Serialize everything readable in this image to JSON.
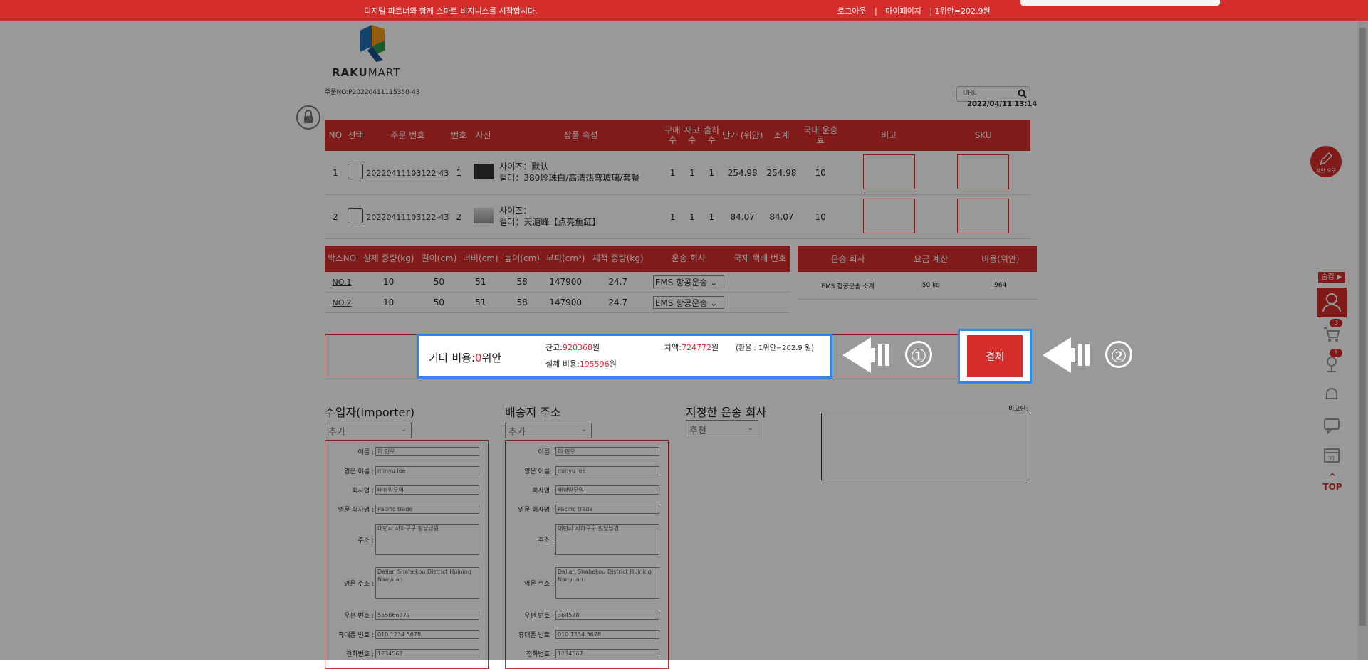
{
  "topbar": {
    "slogan": "디지털 파트너와 함께 스마트 비지니스를 시작합시다.",
    "logout": "로그아웃",
    "sep": "|",
    "mypage": "마이페이지",
    "rate": "| 1위안=202.9원"
  },
  "logo": {
    "text_a": "RAKU",
    "text_b": "MART"
  },
  "order_no": "주문NO:P20220411115350-43",
  "search": {
    "placeholder": "URL"
  },
  "datetime": "2022/04/11 13:14",
  "products": {
    "headers": [
      "NO",
      "선택",
      "주문 번호",
      "번호",
      "사진",
      "상품 속성",
      "구매수",
      "재고수",
      "출하수",
      "단가 (위안)",
      "소계",
      "국내 운송료",
      "비고",
      "SKU"
    ],
    "rows": [
      {
        "no": "1",
        "order": "20220411103122-43",
        "num": "1",
        "size": "사이즈：默认",
        "color": "컬러：380珍珠白/高清热弯玻璃/套餐",
        "buy": "1",
        "stock": "1",
        "ship": "1",
        "price": "254.98",
        "subtotal": "254.98",
        "domestic": "10"
      },
      {
        "no": "2",
        "order": "20220411103122-43",
        "num": "2",
        "size": "사이즈：",
        "color": "컬러：天溏峰【点亮鱼缸】",
        "buy": "1",
        "stock": "1",
        "ship": "1",
        "price": "84.07",
        "subtotal": "84.07",
        "domestic": "10"
      }
    ]
  },
  "boxes": {
    "headers": [
      "박스NO",
      "실제 중량(kg)",
      "길이(cm)",
      "너비(cm)",
      "높이(cm)",
      "부피(cm³)",
      "체적 중량(kg)",
      "운송 회사",
      "국제 택배 번호"
    ],
    "rows": [
      {
        "box": "NO.1",
        "weight": "10",
        "length": "50",
        "width": "51",
        "height": "58",
        "volume": "147900",
        "vol_weight": "24.7",
        "carrier": "EMS 항공운송"
      },
      {
        "box": "NO.2",
        "weight": "10",
        "length": "50",
        "width": "51",
        "height": "58",
        "volume": "147900",
        "vol_weight": "24.7",
        "carrier": "EMS 항공운송"
      }
    ]
  },
  "shipping_fee": {
    "headers": [
      "운송 회사",
      "요금 계산",
      "비용(위안)"
    ],
    "row": {
      "carrier": "EMS 항공운송 소계",
      "calc": "50 kg",
      "cost": "964"
    }
  },
  "payment": {
    "other_label": "기타 비용:",
    "other_value": "0",
    "other_unit": "위안",
    "balance_label": "잔고:",
    "balance_value": "920368",
    "balance_unit": "원",
    "actual_label": "실제 비용:",
    "actual_value": "195596",
    "actual_unit": "원",
    "diff_label": "차액:",
    "diff_value": "724772",
    "diff_unit": "원",
    "rate": "(환율 : 1위안=202.9 원)",
    "pay_button": "결제",
    "step1": "①",
    "step2": "②"
  },
  "importer": {
    "title": "수입자(Importer)",
    "select": "추가",
    "labels": [
      "이름 :",
      "영문 이름 :",
      "회사명 :",
      "영문 회사명 :",
      "주소 :",
      "영문 주소 :",
      "우편 번호 :",
      "휴대폰 번호 :",
      "전화번호 :"
    ],
    "values": [
      "이 민우",
      "minyu lee",
      "태평양무역",
      "Pacific trade",
      "대련시 사하구구 훤닝남원",
      "Dalian Shahekou District Huining Nanyuan",
      "555666777",
      "010 1234 5678",
      "1234567"
    ]
  },
  "delivery": {
    "title": "배송지 주소",
    "select": "추가",
    "labels": [
      "이름 :",
      "영문 이름 :",
      "회사명 :",
      "영문 회사명 :",
      "주소 :",
      "영문 주소 :",
      "우편 번호 :",
      "휴대폰 번호 :",
      "전화번호 :"
    ],
    "values": [
      "이 민우",
      "minyu lee",
      "태평양무역",
      "Pacific trade",
      "대련시 사하구구 훤닝남원",
      "Dalian Shahekou District Huining Nanyuan",
      "364578",
      "010 1234 5678",
      "1234567"
    ]
  },
  "carrier_select": {
    "title": "지정한 운송 회사",
    "select": "추천"
  },
  "note_label": "비고란:",
  "sidebar": {
    "hide": "숨김 ▶",
    "cart_count": "3",
    "fav_count": "1",
    "top": "TOP",
    "request": "제안 요구"
  },
  "colors": {
    "brand": "#d52d2c",
    "highlight": "#2b8ae6"
  }
}
